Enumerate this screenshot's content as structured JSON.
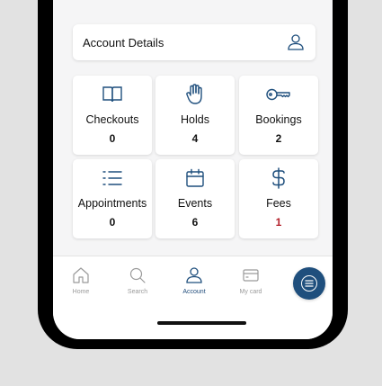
{
  "account_details": {
    "label": "Account Details",
    "icon": "user-icon"
  },
  "tiles": [
    {
      "label": "Checkouts",
      "count": "0",
      "icon": "book-icon"
    },
    {
      "label": "Holds",
      "count": "4",
      "icon": "hand-icon"
    },
    {
      "label": "Bookings",
      "count": "2",
      "icon": "key-icon"
    },
    {
      "label": "Appointments",
      "count": "0",
      "icon": "list-icon"
    },
    {
      "label": "Events",
      "count": "6",
      "icon": "calendar-icon"
    },
    {
      "label": "Fees",
      "count": "1",
      "icon": "dollar-icon"
    }
  ],
  "tabbar": {
    "items": [
      {
        "label": "Home",
        "icon": "home-icon"
      },
      {
        "label": "Search",
        "icon": "search-icon"
      },
      {
        "label": "Account",
        "icon": "user-icon"
      },
      {
        "label": "My card",
        "icon": "card-icon"
      }
    ],
    "active": "Account",
    "menu_icon": "menu-icon"
  },
  "colors": {
    "accent": "#1f4f7d",
    "fee_alert": "#b3202a",
    "inactive_tab": "#9a9a9a",
    "background": "#e2e2e2"
  }
}
